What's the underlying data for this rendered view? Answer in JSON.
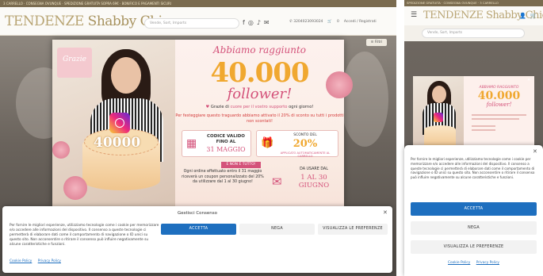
{
  "desktop": {
    "topbar_text": "3 CARRELLO · CONSEGNA OVUNQUE · SPEDIZIONE GRATUITA SOPRA 69€ · BONIFICO E PAGAMENTI SICURI",
    "logo_part1": "TENDENZE",
    "logo_part2": "Shabby Chic",
    "search_placeholder": "Vende, Sort, Imports",
    "phone": "✆ 3204023093024",
    "cart_count": "0",
    "account_label": "Accedi / Registrati",
    "filter_label": "Filtri"
  },
  "promo": {
    "reached": "Abbiamo raggiunto",
    "big_number": "40.000",
    "follower": "follower!",
    "thanks_pre": "Grazie di ",
    "thanks_heart": "cuore per il vostro supporto",
    "thanks_post": " ogni giorno!",
    "celebrate": "Per festeggiare questo traguardo abbiamo attivato il 20% di sconto su tutti i prodotti non scontati!",
    "code_valid": "CODICE VALIDO FINO AL",
    "code_date": "31 MAGGIO",
    "discount_pre": "SCONTO DEL",
    "discount_value": "20%",
    "discount_applied": "APPLICATO AUTOMATICAMENTE AL CARRELLO",
    "not_all": "E NON È TUTTO!",
    "extra": "Ogni ordine effettuato entro il 31 maggio riceverà un coupon personalizzato del 20% da utilizzare dal 1 al 30 giugno!",
    "use_from": "DA USARE DAL",
    "use_dates": "1 AL 30 GIUGNO",
    "cake_number": "40000",
    "photo_caption": "Grazie"
  },
  "cookie": {
    "title": "Gestisci Consenso",
    "text": "Per fornire le migliori esperienze, utilizziamo tecnologie come i cookie per memorizzare e/o accedere alle informazioni del dispositivo. Il consenso a queste tecnologie ci permetterà di elaborare dati come il comportamento di navigazione o ID unici su questo sito. Non acconsentire o ritirare il consenso può influire negativamente su alcune caratteristiche e funzioni.",
    "accept": "ACCETTA",
    "deny": "NEGA",
    "prefs": "VISUALIZZA LE PREFERENZE",
    "link_cookie": "Cookie Policy",
    "link_privacy": "Privacy Policy"
  },
  "mobile": {
    "topbar_text": "SPEDIZIONE GRATUITA · CONSEGNA OVUNQUE · 3 CARRELLO",
    "logo": "TENDENZE Shabby Chic",
    "search_placeholder": "Vende, Sort, Imports",
    "promo_reached": "ABBIAMO RAGGIUNTO",
    "promo_number": "40.000",
    "promo_follower": "follower!"
  },
  "colors": {
    "accent_blue": "#1e6fbf",
    "pink": "#d4527a",
    "gold": "#f0a830",
    "brand": "#b9a574"
  }
}
